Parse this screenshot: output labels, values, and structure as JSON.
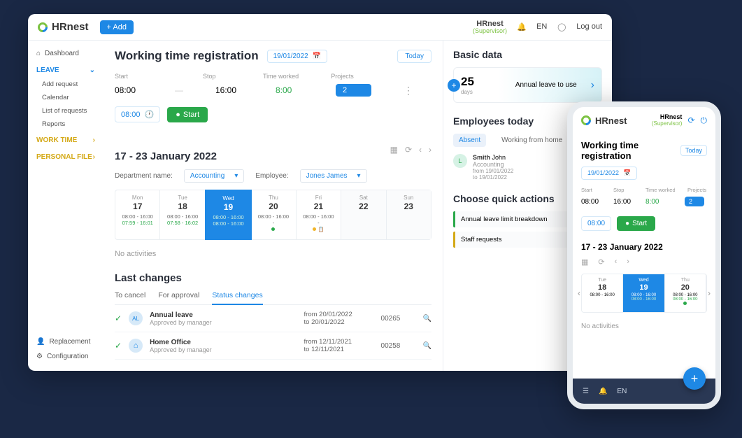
{
  "brand": "HRnest",
  "add_btn": "+ Add",
  "user": {
    "name": "HRnest",
    "role": "(Supervisor)"
  },
  "lang": "EN",
  "logout": "Log out",
  "sidebar": {
    "dashboard": "Dashboard",
    "leave": "LEAVE",
    "leave_items": [
      "Add request",
      "Calendar",
      "List of requests",
      "Reports"
    ],
    "worktime": "WORK TIME",
    "personal": "PERSONAL FILE",
    "replacement": "Replacement",
    "configuration": "Configuration"
  },
  "main": {
    "title": "Working time registration",
    "date": "19/01/2022",
    "today": "Today",
    "headers": {
      "start": "Start",
      "stop": "Stop",
      "worked": "Time worked",
      "projects": "Projects"
    },
    "values": {
      "start": "08:00",
      "dash": "—",
      "stop": "16:00",
      "worked": "8:00",
      "projects": "2"
    },
    "input_time": "08:00",
    "start_btn": "Start",
    "range": "17 - 23 January 2022",
    "dept_label": "Department name:",
    "dept_value": "Accounting",
    "emp_label": "Employee:",
    "emp_value": "Jones James",
    "week": [
      {
        "name": "Mon",
        "num": "17",
        "t1": "08:00 - 16:00",
        "t2": "07:59 - 16:01"
      },
      {
        "name": "Tue",
        "num": "18",
        "t1": "08:00 - 16:00",
        "t2": "07:58 - 16:02"
      },
      {
        "name": "Wed",
        "num": "19",
        "t1": "08:00 - 16:00",
        "t2": "08:00 - 16:00"
      },
      {
        "name": "Thu",
        "num": "20",
        "t1": "08:00 - 16:00",
        "t2": "-"
      },
      {
        "name": "Fri",
        "num": "21",
        "t1": "08:00 - 16:00",
        "t2": "-"
      },
      {
        "name": "Sat",
        "num": "22"
      },
      {
        "name": "Sun",
        "num": "23"
      }
    ],
    "no_activities": "No activities",
    "last_changes": "Last changes",
    "tabs": [
      "To cancel",
      "For approval",
      "Status changes"
    ],
    "changes": [
      {
        "av": "AL",
        "title": "Annual leave",
        "sub": "Approved by manager",
        "from": "from  20/01/2022",
        "to": "to  20/01/2022",
        "id": "00265"
      },
      {
        "av": "⌂",
        "title": "Home Office",
        "sub": "Approved by manager",
        "from": "from  12/11/2021",
        "to": "to  12/11/2021",
        "id": "00258"
      }
    ]
  },
  "right": {
    "basic": "Basic data",
    "leave_num": "25",
    "leave_days": "days",
    "leave_text": "Annual leave to use",
    "employees": "Employees today",
    "etabs": [
      "Absent",
      "Working from home"
    ],
    "emp": {
      "av": "L",
      "surname": "Smith",
      "first": "John",
      "dept": "Accounting",
      "from": "from 19/01/2022",
      "to": "to 19/01/2022"
    },
    "quick": "Choose quick actions",
    "qa1": "Annual leave limit breakdown",
    "qa2": "Staff requests"
  },
  "mobile": {
    "title": "Working time registration",
    "range": "17 - 23 January 2022",
    "no_activities": "No activities",
    "week": [
      {
        "name": "Tue",
        "num": "18",
        "t1": "08:00 - 16:00"
      },
      {
        "name": "Wed",
        "num": "19",
        "t1": "08:00 - 16:00",
        "t2": "08:00 - 16:00"
      },
      {
        "name": "Thu",
        "num": "20",
        "t1": "08:00 - 16:00",
        "t2": "08:00 - 16:00"
      }
    ]
  }
}
